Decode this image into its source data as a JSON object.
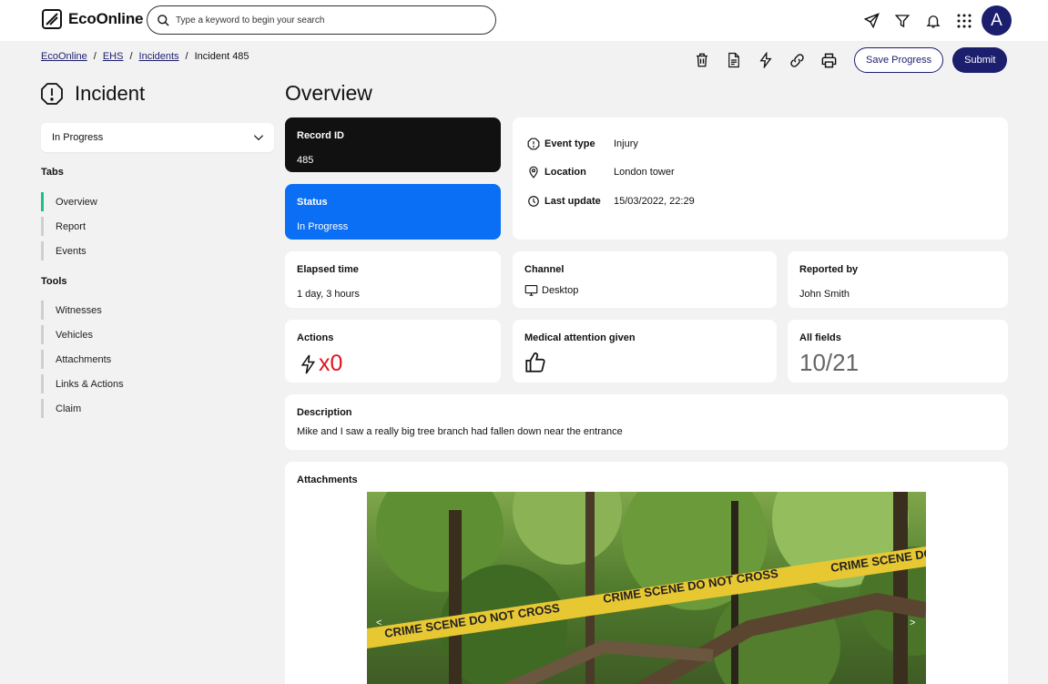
{
  "brand": {
    "name": "EcoOnline"
  },
  "search": {
    "placeholder": "Type a keyword to begin your search"
  },
  "user": {
    "initial": "A"
  },
  "breadcrumb": {
    "items": [
      "EcoOnline",
      "EHS",
      "Incidents"
    ],
    "current": "Incident 485",
    "separator": "/"
  },
  "toolbar": {
    "save_label": "Save Progress",
    "submit_label": "Submit"
  },
  "sidebar": {
    "title": "Incident",
    "status_value": "In Progress",
    "tabs_heading": "Tabs",
    "tabs": [
      "Overview",
      "Report",
      "Events"
    ],
    "tools_heading": "Tools",
    "tools": [
      "Witnesses",
      "Vehicles",
      "Attachments",
      "Links & Actions",
      "Claim"
    ]
  },
  "main": {
    "title": "Overview",
    "record": {
      "label": "Record ID",
      "value": "485"
    },
    "status": {
      "label": "Status",
      "value": "In Progress"
    },
    "event_type": {
      "label": "Event type",
      "value": "Injury"
    },
    "location": {
      "label": "Location",
      "value": "London tower"
    },
    "last_update": {
      "label": "Last update",
      "value": "15/03/2022, 22:29"
    },
    "elapsed": {
      "label": "Elapsed time",
      "value": "1 day, 3 hours"
    },
    "channel": {
      "label": "Channel",
      "value": "Desktop"
    },
    "reported_by": {
      "label": "Reported by",
      "value": "John Smith"
    },
    "actions": {
      "label": "Actions",
      "value": "x0"
    },
    "medical": {
      "label": "Medical attention given"
    },
    "all_fields": {
      "label": "All fields",
      "value": "10/21"
    },
    "description": {
      "label": "Description",
      "value": "Mike and I saw a really big tree branch had fallen down near the entrance"
    },
    "attachments": {
      "label": "Attachments",
      "prev": "<",
      "next": ">",
      "tape_text": "CRIME SCENE DO NOT CROSS"
    }
  },
  "colors": {
    "brand_navy": "#1c1e6e",
    "status_blue": "#0b6ff5",
    "active_tab": "#19c28b",
    "actions_red": "#e0141e"
  }
}
